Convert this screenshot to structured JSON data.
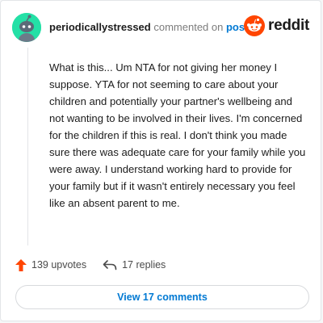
{
  "header": {
    "username": "periodicallystressed",
    "commented_on_text": "commented on",
    "post_link_text": "post",
    "brand_wordmark": "reddit"
  },
  "comment": {
    "body": "What is this... Um NTA for not giving her money I suppose. YTA for not seeming to care about your children and potentially your partner's wellbeing and not wanting to be involved in their lives. I'm concerned for the children if this is real. I don't think you made sure there was adequate care for your family while you were away. I understand working hard to provide for your family but if it wasn't entirely necessary you feel like an absent parent to me."
  },
  "actions": {
    "upvotes_label": "139 upvotes",
    "replies_label": "17 replies",
    "view_comments_label": "View 17 comments"
  },
  "colors": {
    "avatar_bg": "#24e0a6",
    "reddit_orange": "#ff4500",
    "link_blue": "#0079d3",
    "upvote_orange": "#ff4500"
  },
  "icons": {
    "avatar": "snoo-avatar-icon",
    "brand": "reddit-logo-icon",
    "upvote": "upvote-arrow-icon",
    "reply": "reply-arrow-icon"
  }
}
